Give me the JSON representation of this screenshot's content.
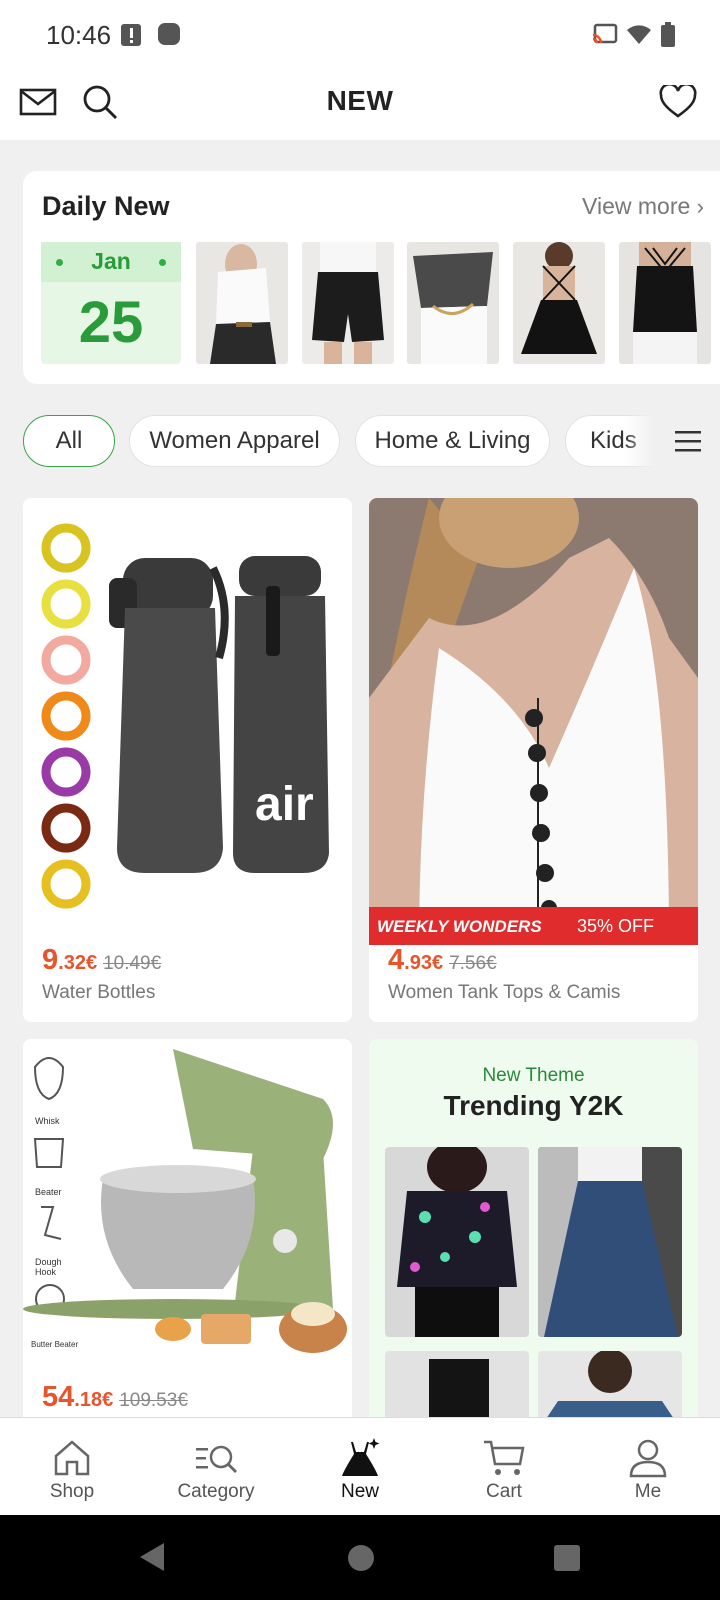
{
  "status_bar": {
    "time": "10:46"
  },
  "header": {
    "title": "NEW",
    "icons": [
      "mail-icon",
      "search-icon",
      "heart-icon"
    ]
  },
  "daily_new": {
    "title": "Daily New",
    "view_more": "View more",
    "date": {
      "month": "Jan",
      "day": "25"
    }
  },
  "categories": {
    "chips": [
      "All",
      "Women Apparel",
      "Home & Living",
      "Kids"
    ],
    "active": "All"
  },
  "products": [
    {
      "price_int": "9",
      "price_dec": ".32€",
      "old_price": "10.49€",
      "name": "Water Bottles"
    },
    {
      "price_int": "4",
      "price_dec": ".93€",
      "old_price": "7.56€",
      "name": "Women Tank Tops & Camis",
      "banner_left": "WEEKLY WONDERS",
      "banner_right": "35% OFF"
    },
    {
      "price_int": "54",
      "price_dec": ".18€",
      "old_price": "109.53€",
      "name": "",
      "attachments": [
        "Whisk",
        "Beater",
        "Dough Hook",
        "Butter Beater"
      ]
    }
  ],
  "theme_card": {
    "subtitle": "New Theme",
    "title": "Trending Y2K"
  },
  "bottom_nav": [
    {
      "label": "Shop",
      "icon": "home-icon"
    },
    {
      "label": "Category",
      "icon": "category-search-icon"
    },
    {
      "label": "New",
      "icon": "dress-icon",
      "active": true
    },
    {
      "label": "Cart",
      "icon": "cart-icon"
    },
    {
      "label": "Me",
      "icon": "person-icon"
    }
  ],
  "colors": {
    "accent_green": "#2a9b3a",
    "price_orange": "#e8542c",
    "banner_red": "#e02c2c"
  }
}
